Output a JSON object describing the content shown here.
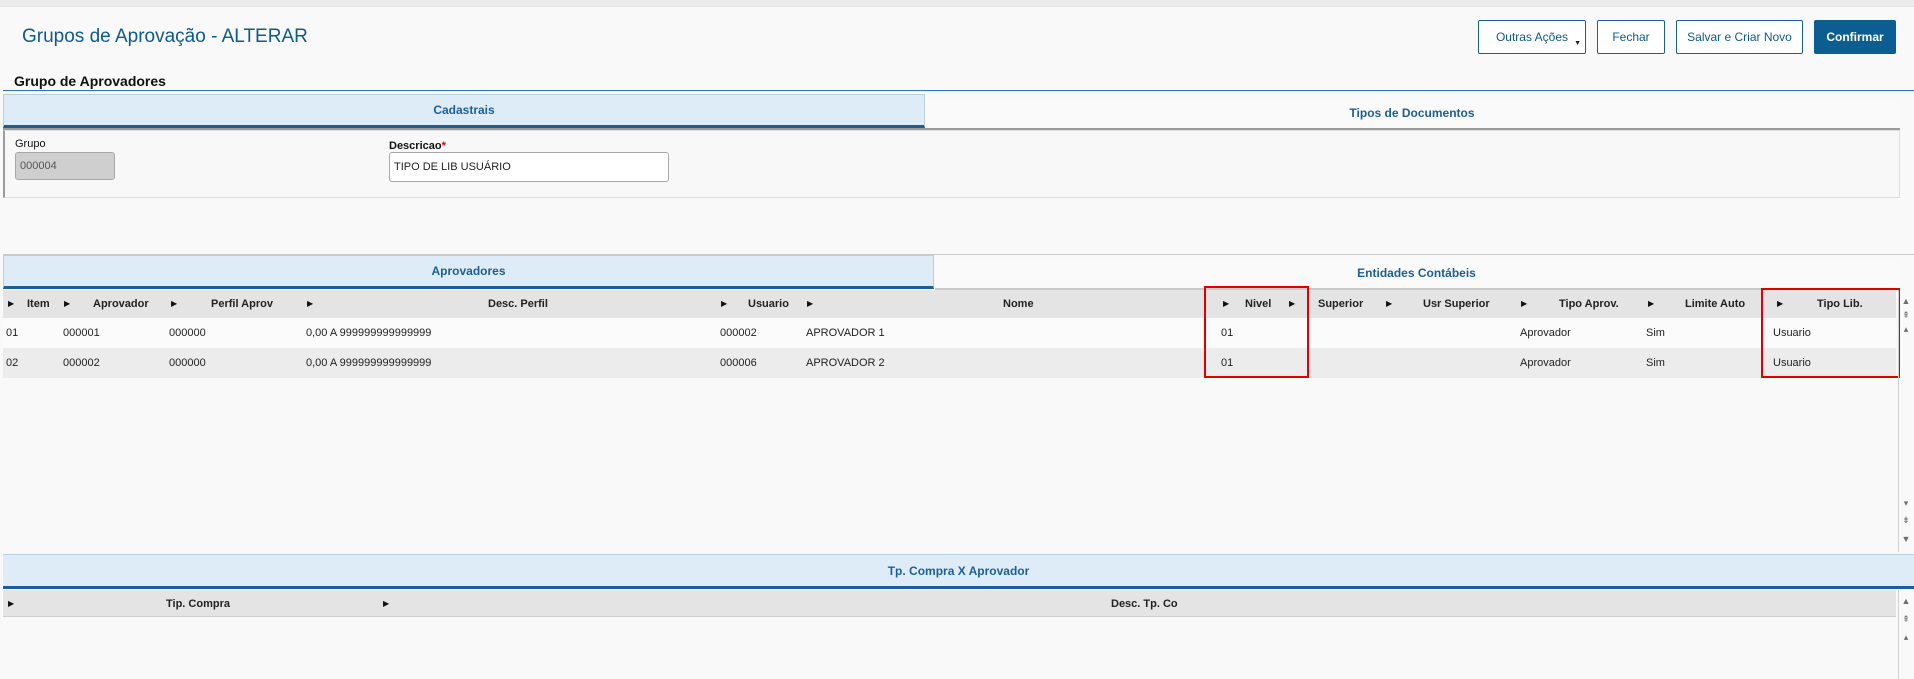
{
  "header": {
    "title": "Grupos de Aprovação - ALTERAR",
    "buttons": {
      "outras_acoes": "Outras Ações",
      "fechar": "Fechar",
      "salvar_criar": "Salvar e Criar Novo",
      "confirmar": "Confirmar"
    }
  },
  "form": {
    "section_title": "Grupo de Aprovadores",
    "tabs": [
      "Cadastrais",
      "Tipos de Documentos"
    ],
    "grupo": {
      "label": "Grupo",
      "value": "000004"
    },
    "descricao": {
      "label": "Descricao",
      "required_mark": "*",
      "value": "TIPO DE LIB USUÁRIO"
    }
  },
  "approvers": {
    "tabs": [
      "Aprovadores",
      "Entidades Contábeis"
    ],
    "columns": [
      "Item",
      "Aprovador",
      "Perfil Aprov",
      "Desc. Perfil",
      "Usuario",
      "Nome",
      "Nivel",
      "Superior",
      "Usr Superior",
      "Tipo Aprov.",
      "Limite Auto",
      "Tipo Lib."
    ],
    "rows": [
      {
        "item": "01",
        "aprovador": "000001",
        "perfil": "000000",
        "desc_perfil": "0,00 A 999999999999999",
        "usuario": "000002",
        "nome": "APROVADOR 1",
        "nivel": "01",
        "superior": "",
        "usr_superior": "",
        "tipo_aprov": "Aprovador",
        "limite_auto": "Sim",
        "tipo_lib": "Usuario"
      },
      {
        "item": "02",
        "aprovador": "000002",
        "perfil": "000000",
        "desc_perfil": "0,00 A 999999999999999",
        "usuario": "000006",
        "nome": "APROVADOR 2",
        "nivel": "01",
        "superior": "",
        "usr_superior": "",
        "tipo_aprov": "Aprovador",
        "limite_auto": "Sim",
        "tipo_lib": "Usuario"
      }
    ]
  },
  "purchase": {
    "tab": "Tp. Compra X Aprovador",
    "columns": [
      "Tip. Compra",
      "Desc. Tp. Co"
    ]
  },
  "colors": {
    "accent": "#0c5e92",
    "highlight": "#e00000",
    "tab_active_bg": "#deecf8"
  }
}
